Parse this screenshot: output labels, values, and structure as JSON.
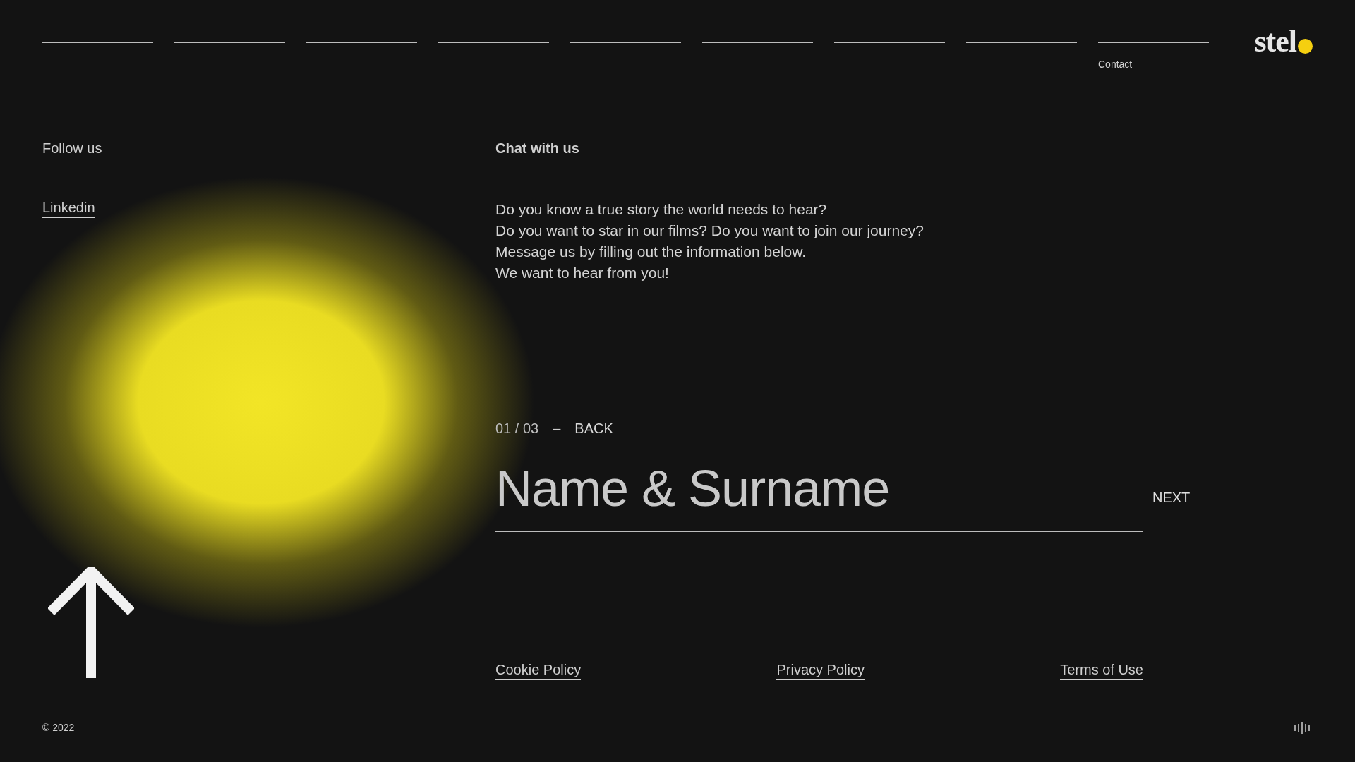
{
  "logo": {
    "text": "stel"
  },
  "nav": [
    {
      "label": "Contact"
    }
  ],
  "follow": {
    "title": "Follow us",
    "links": [
      "Linkedin"
    ]
  },
  "chat": {
    "title": "Chat with us",
    "lines": [
      "Do you know a true story the world needs to hear?",
      "Do you want to star in our films? Do you want to join our journey?",
      "Message us by filling out the information below.",
      "We want to hear from you!"
    ]
  },
  "form": {
    "step": "01 / 03",
    "separator": "–",
    "back": "BACK",
    "placeholder": "Name & Surname",
    "next": "NEXT"
  },
  "footer_links": [
    "Cookie Policy",
    "Privacy Policy",
    "Terms of Use"
  ],
  "copyright": "© 2022"
}
